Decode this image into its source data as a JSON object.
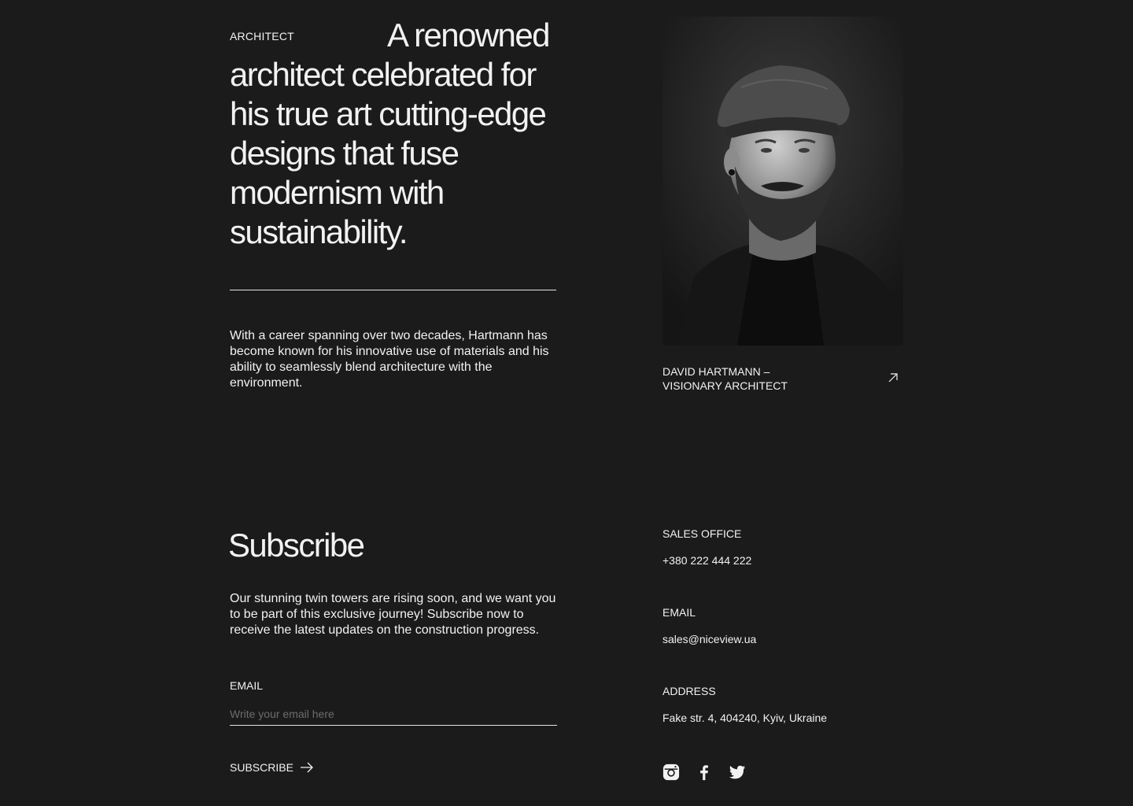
{
  "architect": {
    "label": "ARCHITECT",
    "headline": "A renowned architect celebrated for his true art cutting-edge designs that fuse modernism with sustainability.",
    "career_text": "With a career spanning over two decades, Hartmann has become known for his innovative use of materials and his ability to seamlessly blend architecture with the environment.",
    "portrait_caption_line1": "DAVID HARTMANN –",
    "portrait_caption_line2": "VISIONARY ARCHITECT",
    "portrait_link_icon": "arrow-up-right-icon"
  },
  "subscribe": {
    "title": "Subscribe",
    "text": "Our stunning twin towers are rising soon, and we want you to be part of this exclusive journey! Subscribe now to receive the latest updates on the construction progress.",
    "email_label": "EMAIL",
    "email_placeholder": "Write your email here",
    "button_label": "SUBSCRIBE",
    "button_icon": "arrow-right-icon"
  },
  "contacts": {
    "sales_label": "SALES OFFICE",
    "sales_phone": "+380 222 444 222",
    "email_label": "EMAIL",
    "email_value": "sales@niceview.ua",
    "address_label": "ADDRESS",
    "address_value": "Fake str. 4, 404240, Kyiv, Ukraine"
  },
  "socials": [
    "instagram-icon",
    "facebook-icon",
    "twitter-icon"
  ],
  "colors": {
    "background": "#1b1b1b",
    "text": "#f2f2f2",
    "placeholder": "#6c6c6c"
  }
}
